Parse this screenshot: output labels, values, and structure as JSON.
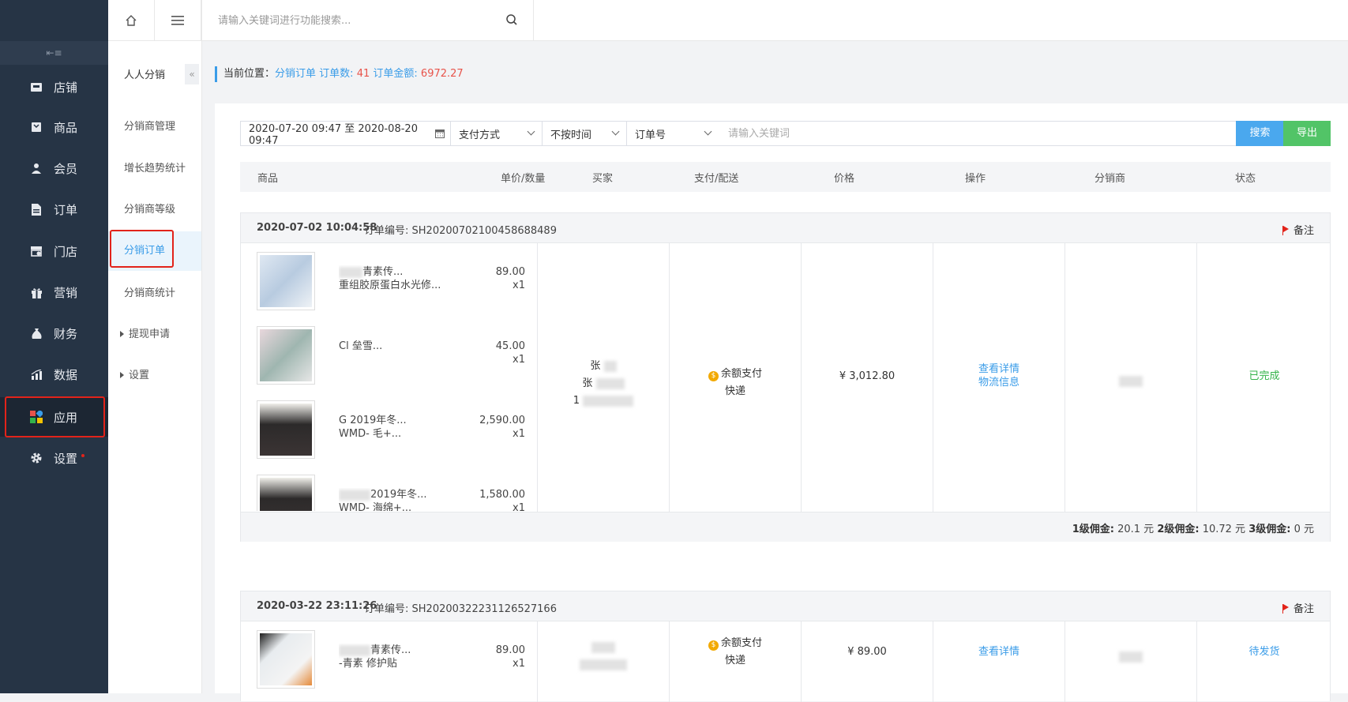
{
  "sidebar": {
    "collapse_glyph": "⇤≡",
    "items": [
      {
        "label": "店铺",
        "icon": "shop-icon"
      },
      {
        "label": "商品",
        "icon": "goods-icon"
      },
      {
        "label": "会员",
        "icon": "member-icon"
      },
      {
        "label": "订单",
        "icon": "order-icon"
      },
      {
        "label": "门店",
        "icon": "store-icon"
      },
      {
        "label": "营销",
        "icon": "gift-icon"
      },
      {
        "label": "财务",
        "icon": "money-bag-icon"
      },
      {
        "label": "数据",
        "icon": "chart-icon"
      },
      {
        "label": "应用",
        "icon": "apps-icon"
      },
      {
        "label": "设置",
        "icon": "gear-icon"
      }
    ],
    "active": "应用"
  },
  "submenu": {
    "title": "人人分销",
    "collapse_glyph": "«",
    "items": [
      "分销商管理",
      "增长趋势统计",
      "分销商等级",
      "分销订单",
      "分销商统计",
      "提现申请",
      "设置"
    ],
    "active": "分销订单"
  },
  "topbar": {
    "search_placeholder": "请输入关键词进行功能搜索..."
  },
  "breadcrumb": {
    "prefix": "当前位置：",
    "page": "分销订单",
    "count_label": "订单数:",
    "count": "41",
    "amount_label": "订单金额:",
    "amount": "6972.27"
  },
  "filters": {
    "date_range": "2020-07-20 09:47 至 2020-08-20 09:47",
    "payment": "支付方式",
    "time": "不按时间",
    "field": "订单号",
    "keyword_placeholder": "请输入关键词",
    "search_btn": "搜索",
    "export_btn": "导出"
  },
  "columns": [
    "商品",
    "单价/数量",
    "买家",
    "支付/配送",
    "价格",
    "操作",
    "分销商",
    "状态"
  ],
  "orders": [
    {
      "time": "2020-07-02 10:04:58",
      "no_label": "订单编号:",
      "no": "SH20200702100458688489",
      "remark": "备注",
      "products": [
        {
          "line1": "青素传...",
          "line2": "重组胶原蛋白水光修...",
          "price": "89.00",
          "qty": "x1"
        },
        {
          "line1": "Cl 垒雪...",
          "line2": "",
          "price": "45.00",
          "qty": "x1"
        },
        {
          "line1": "G 2019年冬...",
          "line2": "WMD- 毛+...",
          "price": "2,590.00",
          "qty": "x1"
        },
        {
          "line1": "2019年冬...",
          "line2": "WMD- 海绵+...",
          "price": "1,580.00",
          "qty": "x1"
        }
      ],
      "buyer": [
        "张",
        "张",
        "1"
      ],
      "pay": "余额支付",
      "delivery": "快递",
      "total": "¥ 3,012.80",
      "actions": [
        "查看详情",
        "物流信息"
      ],
      "status": "已完成",
      "commission": {
        "l1_label": "1级佣金:",
        "l1": "20.1 元",
        "l2_label": "2级佣金:",
        "l2": "10.72 元",
        "l3_label": "3级佣金:",
        "l3": "0 元"
      }
    },
    {
      "time": "2020-03-22 23:11:26",
      "no_label": "订单编号:",
      "no": "SH20200322231126527166",
      "remark": "备注",
      "products": [
        {
          "line1": "青素传...",
          "line2": "-青素 修护贴",
          "price": "89.00",
          "qty": "x1"
        }
      ],
      "pay": "余额支付",
      "delivery": "快递",
      "total": "¥ 89.00",
      "actions": [
        "查看详情"
      ],
      "status": "待发货"
    }
  ]
}
